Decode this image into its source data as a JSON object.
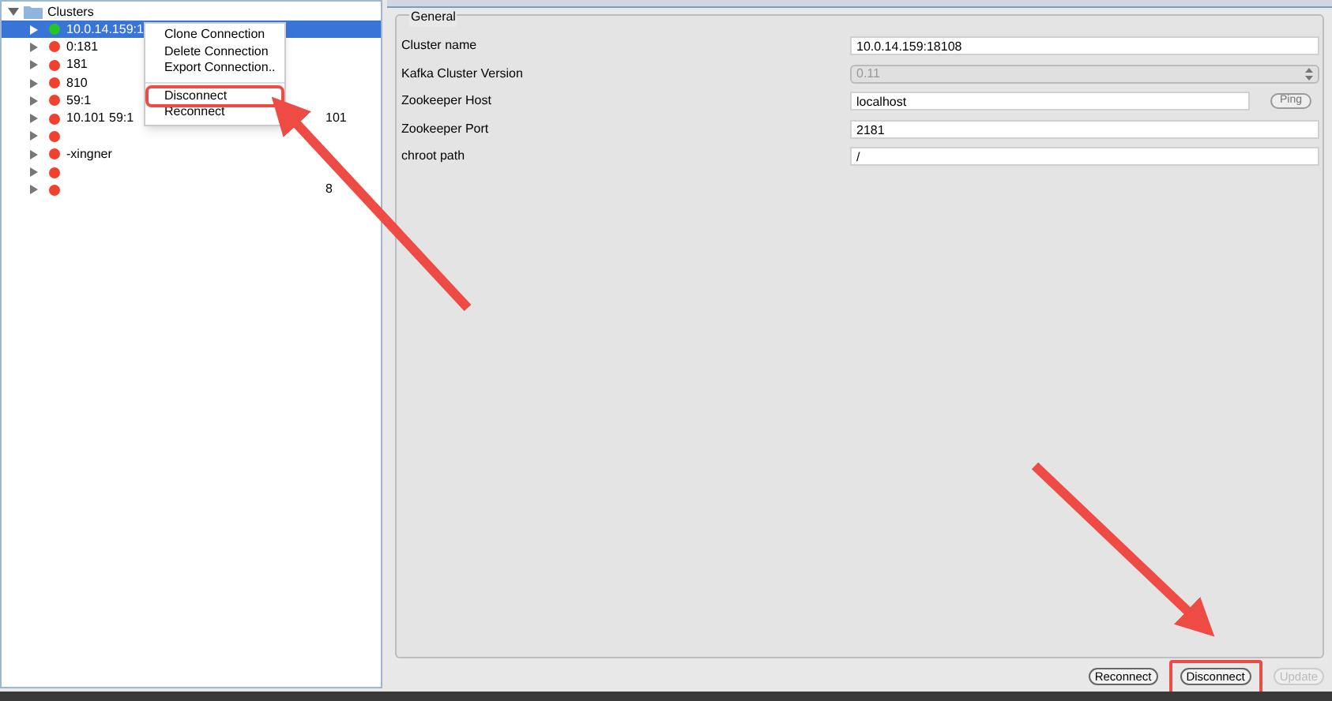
{
  "tree": {
    "root": {
      "label": "Clusters",
      "expanded": true
    },
    "children": [
      {
        "label": "10.0.14.159:1",
        "color": "#27c427",
        "selected": true
      },
      {
        "label": "0:181",
        "color": "#f0402e",
        "selected": false
      },
      {
        "label": "181",
        "color": "#f0402e",
        "selected": false
      },
      {
        "label": "810",
        "color": "#f0402e",
        "selected": false
      },
      {
        "label": "59:1",
        "color": "#f0402e",
        "selected": false
      },
      {
        "label": "10.101",
        "middle": "59:1",
        "suffix": "101",
        "color": "#f0402e",
        "selected": false
      },
      {
        "color": "#f0402e",
        "selected": false
      },
      {
        "label": "-xingner",
        "color": "#f0402e",
        "selected": false
      },
      {
        "color": "#f0402e",
        "selected": false
      },
      {
        "suffix": "8",
        "color": "#f0402e",
        "selected": false
      }
    ]
  },
  "context_menu": {
    "items": [
      {
        "kind": "item",
        "label": "Clone Connection",
        "highlighted": false
      },
      {
        "kind": "item",
        "label": "Delete Connection",
        "highlighted": false
      },
      {
        "kind": "item",
        "label": "Export Connection..",
        "highlighted": false
      },
      {
        "kind": "separator"
      },
      {
        "kind": "item",
        "label": "Disconnect",
        "highlighted": true
      },
      {
        "kind": "item",
        "label": "Reconnect",
        "highlighted": false
      }
    ]
  },
  "general": {
    "title": "General",
    "fields": [
      {
        "kind": "text",
        "label": "Cluster name",
        "value": "10.0.14.159:18108"
      },
      {
        "kind": "select",
        "label": "Kafka Cluster Version",
        "value": "0.11",
        "disabled": true
      },
      {
        "kind": "text_button",
        "label": "Zookeeper Host",
        "value": "localhost",
        "button": "Ping"
      },
      {
        "kind": "text",
        "label": "Zookeeper Port",
        "value": "2181"
      },
      {
        "kind": "text",
        "label": "chroot path",
        "value": "/"
      }
    ]
  },
  "buttons": [
    {
      "label": "Reconnect",
      "disabled": false,
      "highlighted": false
    },
    {
      "label": "Disconnect",
      "disabled": false,
      "highlighted": true
    },
    {
      "label": "Update",
      "disabled": true,
      "highlighted": false
    }
  ]
}
